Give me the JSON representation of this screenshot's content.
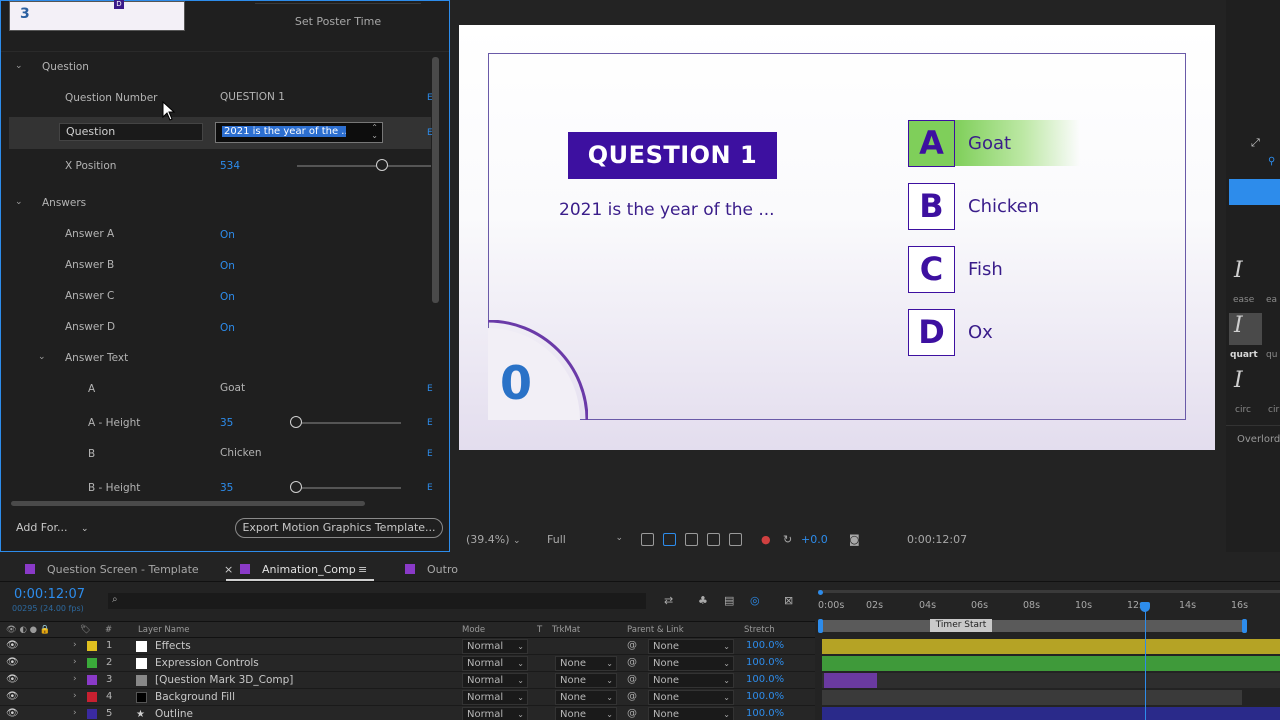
{
  "eg_panel": {
    "thumb_number": "3",
    "thumb_d": "D",
    "set_poster_time": "Set Poster Time",
    "sections": {
      "question": "Question",
      "answers": "Answers",
      "answer_text": "Answer Text"
    },
    "rows": {
      "question_number_label": "Question Number",
      "question_number_value": "QUESTION 1",
      "question_label": "Question",
      "question_value": "2021 is the year of the ...",
      "x_position_label": "X Position",
      "x_position_value": "534",
      "answer_a_label": "Answer A",
      "answer_a_value": "On",
      "answer_b_label": "Answer B",
      "answer_b_value": "On",
      "answer_c_label": "Answer C",
      "answer_c_value": "On",
      "answer_d_label": "Answer D",
      "answer_d_value": "On",
      "a_label": "A",
      "a_value": "Goat",
      "a_height_label": "A - Height",
      "a_height_value": "35",
      "b_label": "B",
      "b_value": "Chicken",
      "b_height_label": "B - Height",
      "b_height_value": "35"
    },
    "add_for": "Add For...",
    "export_button": "Export Motion Graphics Template..."
  },
  "composition": {
    "question_badge": "QUESTION 1",
    "question_text": "2021 is the year of the ...",
    "answers": [
      {
        "letter": "A",
        "text": "Goat"
      },
      {
        "letter": "B",
        "text": "Chicken"
      },
      {
        "letter": "C",
        "text": "Fish"
      },
      {
        "letter": "D",
        "text": "Ox"
      }
    ],
    "timer_value": "0"
  },
  "viewer_toolbar": {
    "zoom": "(39.4%)",
    "resolution": "Full",
    "exposure": "+0.0",
    "timecode": "0:00:12:07"
  },
  "right_panel": {
    "ease_labels": [
      "ease",
      "ea",
      "quart",
      "qu",
      "circ",
      "cir"
    ],
    "overlord": "Overlord"
  },
  "timeline": {
    "tabs": [
      {
        "label": "Question Screen - Template",
        "color": "#8a3ac8"
      },
      {
        "label": "Animation_Comp",
        "color": "#8a3ac8"
      },
      {
        "label": "Outro",
        "color": "#8a3ac8"
      }
    ],
    "timecode": "0:00:12:07",
    "fps": "00295 (24.00 fps)",
    "columns": {
      "layer_name": "Layer Name",
      "mode": "Mode",
      "t": "T",
      "trkmat": "TrkMat",
      "parent": "Parent & Link",
      "stretch": "Stretch"
    },
    "ruler_ticks": [
      "0:00s",
      "02s",
      "04s",
      "06s",
      "08s",
      "10s",
      "12s",
      "14s",
      "16s"
    ],
    "marker": "Timer Start",
    "layers": [
      {
        "num": "1",
        "name": "Effects",
        "mode": "Normal",
        "trkmat": "",
        "parent": "None",
        "stretch": "100.0%",
        "label_color": "#e0c020",
        "icon_color": "#ffffff",
        "track_color": "#b5a325"
      },
      {
        "num": "2",
        "name": "Expression Controls",
        "mode": "Normal",
        "trkmat": "None",
        "parent": "None",
        "stretch": "100.0%",
        "label_color": "#3aaa3a",
        "icon_color": "#ffffff",
        "track_color": "#3f9a3a"
      },
      {
        "num": "3",
        "name": "[Question Mark 3D_Comp]",
        "mode": "Normal",
        "trkmat": "None",
        "parent": "None",
        "stretch": "100.0%",
        "label_color": "#8a3ac8",
        "icon_color": "#888888",
        "track_color": "#6a3aa0"
      },
      {
        "num": "4",
        "name": "Background Fill",
        "mode": "Normal",
        "trkmat": "None",
        "parent": "None",
        "stretch": "100.0%",
        "label_color": "#c82030",
        "icon_color": "#000000",
        "track_color": "#3a3a3a"
      },
      {
        "num": "5",
        "name": "Outline",
        "mode": "Normal",
        "trkmat": "None",
        "parent": "None",
        "stretch": "100.0%",
        "label_color": "#3a2aa0",
        "icon_color": "#888888",
        "track_color": "#2a2a8a"
      }
    ]
  },
  "colors": {
    "accent_blue": "#2d8ceb",
    "brand_purple": "#3d10a0",
    "answer_highlight": "#7fcf5a"
  }
}
